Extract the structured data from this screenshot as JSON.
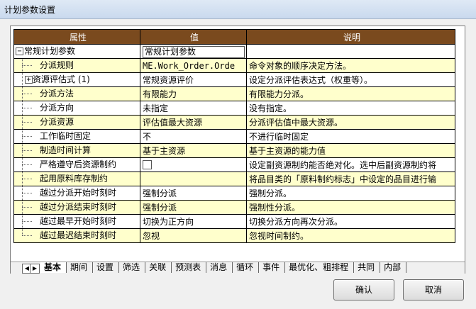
{
  "window": {
    "title": "计划参数设置"
  },
  "grid": {
    "headers": [
      "属性",
      "值",
      "说明"
    ],
    "rows": [
      {
        "name": "常规计划参数",
        "value": "常规计划参数",
        "desc": ""
      },
      {
        "name": "分派规则",
        "value": "ME.Work_Order.Orde",
        "desc": "命令对象的顺序决定方法。"
      },
      {
        "name": "资源评估式 (1)",
        "value": "常规资源评价",
        "desc": "设定分派评估表达式（权重等）。"
      },
      {
        "name": "分派方法",
        "value": "有限能力",
        "desc": "有限能力分派。"
      },
      {
        "name": "分派方向",
        "value": "未指定",
        "desc": "没有指定。"
      },
      {
        "name": "分派资源",
        "value": "评估值最大资源",
        "desc": "分派评估值中最大资源。"
      },
      {
        "name": "工作临时固定",
        "value": "不",
        "desc": "不进行临时固定"
      },
      {
        "name": "制造时间计算",
        "value": "基于主资源",
        "desc": "基于主资源的能力值"
      },
      {
        "name": "严格遵守后资源制约",
        "value": "",
        "desc": "设定副资源制约能否绝对化。选中后副资源制约将"
      },
      {
        "name": "起用原料库存制约",
        "value": "",
        "desc": "将品目类的「原料制约标志」中设定的品目进行输"
      },
      {
        "name": "越过分派开始时刻时",
        "value": "强制分派",
        "desc": "强制分派。"
      },
      {
        "name": "越过分派结束时刻时",
        "value": "强制分派",
        "desc": "强制性分派。"
      },
      {
        "name": "越过最早开始时刻时",
        "value": "切换为正方向",
        "desc": "切换分派方向再次分派。"
      },
      {
        "name": "越过最迟结束时刻时",
        "value": "忽视",
        "desc": "忽视时间制约。"
      }
    ]
  },
  "tabs": [
    "基本",
    "期间",
    "设置",
    "筛选",
    "关联",
    "预测表",
    "消息",
    "循环",
    "事件",
    "最优化、粗排程",
    "共同",
    "内部"
  ],
  "nav": {
    "prev": "◀",
    "next": "▶"
  },
  "tree_glyphs": {
    "minus": "−",
    "plus": "+"
  },
  "buttons": {
    "ok": "确认",
    "cancel": "取消"
  }
}
